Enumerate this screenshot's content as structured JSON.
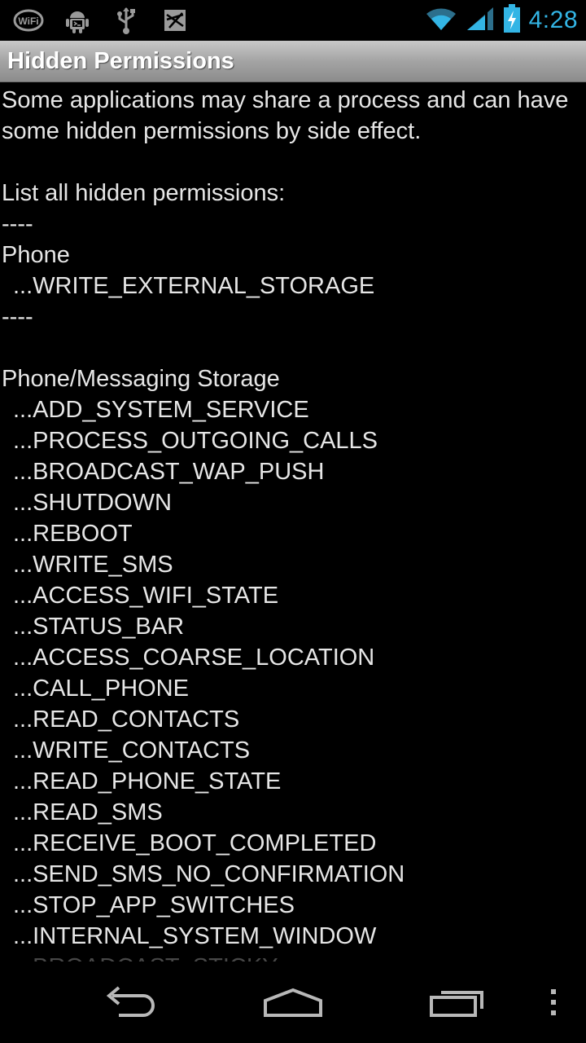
{
  "status_bar": {
    "time": "4:28",
    "left_icons": [
      "wifi-icon",
      "android-debug-icon",
      "usb-icon",
      "notification-icon"
    ],
    "right_icons": [
      "wifi-signal-icon",
      "cell-signal-icon",
      "battery-charging-icon"
    ],
    "accent_color": "#33b5e5"
  },
  "title_bar": {
    "title": "Hidden Permissions"
  },
  "content": {
    "intro_text": "Some applications may share a process and can have some hidden permissions by side effect.",
    "list_heading": "List all hidden permissions:",
    "separator": "----",
    "groups": [
      {
        "name": "Phone",
        "permissions": [
          "...WRITE_EXTERNAL_STORAGE"
        ]
      },
      {
        "name": "Phone/Messaging Storage",
        "permissions": [
          "...ADD_SYSTEM_SERVICE",
          "...PROCESS_OUTGOING_CALLS",
          "...BROADCAST_WAP_PUSH",
          "...SHUTDOWN",
          "...REBOOT",
          "...WRITE_SMS",
          "...ACCESS_WIFI_STATE",
          "...STATUS_BAR",
          "...ACCESS_COARSE_LOCATION",
          "...CALL_PHONE",
          "...READ_CONTACTS",
          "...WRITE_CONTACTS",
          "...READ_PHONE_STATE",
          "...READ_SMS",
          "...RECEIVE_BOOT_COMPLETED",
          "...SEND_SMS_NO_CONFIRMATION",
          "...STOP_APP_SWITCHES",
          "...INTERNAL_SYSTEM_WINDOW",
          "...BROADCAST_STICKY"
        ]
      }
    ]
  },
  "nav_bar": {
    "buttons": [
      "back-icon",
      "home-icon",
      "recent-apps-icon",
      "menu-overflow-icon"
    ]
  }
}
